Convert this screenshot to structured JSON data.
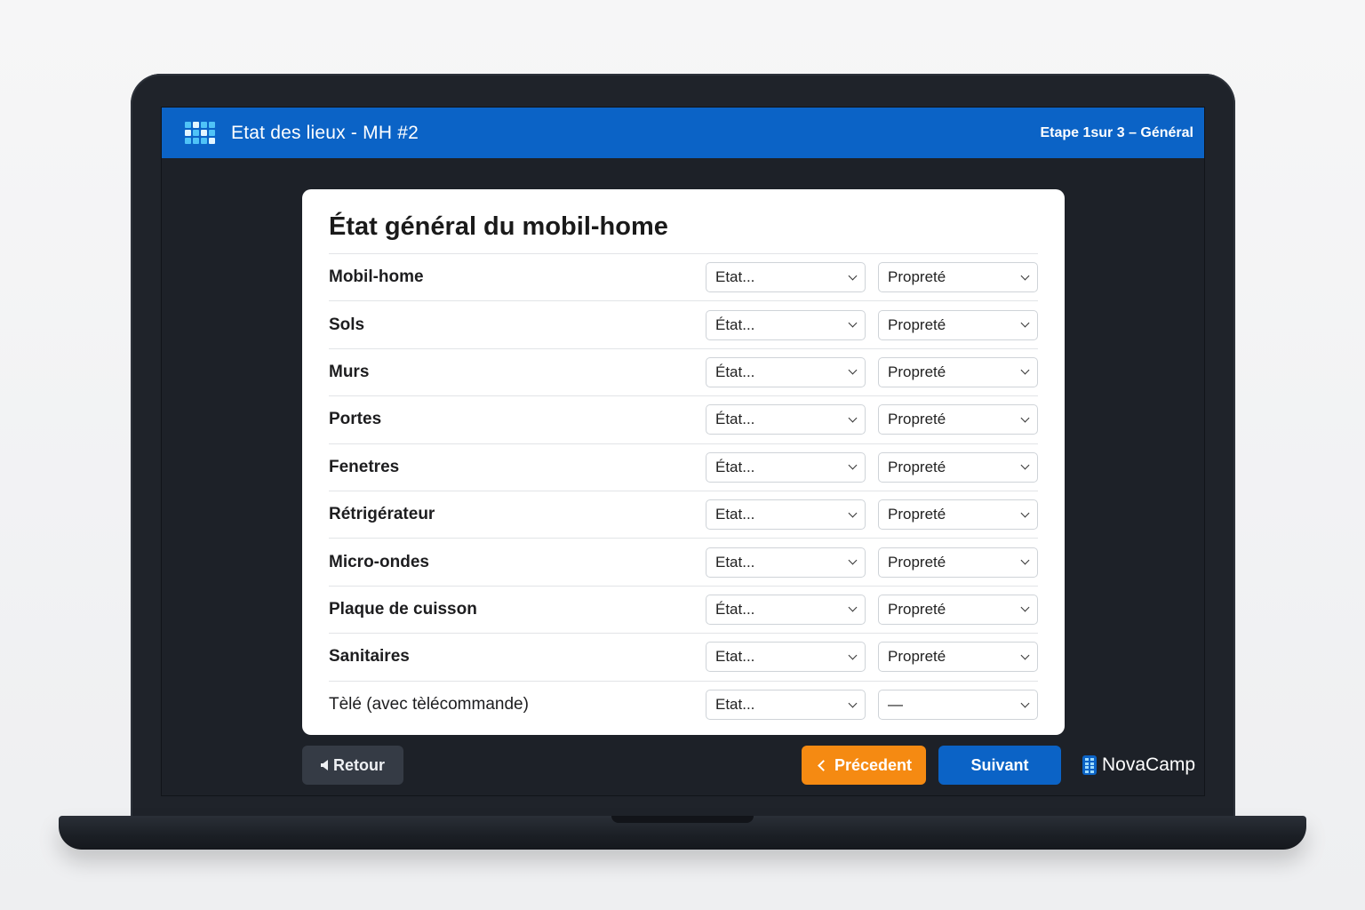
{
  "header": {
    "title": "Etat des lieux - MH #2",
    "step": "Etape 1sur 3 – Général",
    "logo_icon": "grid-logo-icon",
    "color": "#0b63c6"
  },
  "card": {
    "title": "État général du mobil-home",
    "rows": [
      {
        "label": "Mobil-home",
        "etat": "Etat...",
        "proprete": "Propreté"
      },
      {
        "label": "Sols",
        "etat": "État...",
        "proprete": "Propreté"
      },
      {
        "label": "Murs",
        "etat": "État...",
        "proprete": "Propreté"
      },
      {
        "label": "Portes",
        "etat": "État...",
        "proprete": "Propreté"
      },
      {
        "label": "Fenetres",
        "etat": "État...",
        "proprete": "Propreté"
      },
      {
        "label": "Rétrigérateur",
        "etat": "Etat...",
        "proprete": "Propreté"
      },
      {
        "label": "Micro-ondes",
        "etat": "Etat...",
        "proprete": "Propreté"
      },
      {
        "label": "Plaque de cuisson",
        "etat": "État...",
        "proprete": "Propreté"
      },
      {
        "label": "Sanitaires",
        "etat": "Etat...",
        "proprete": "Propreté"
      },
      {
        "label": "Tèlé (avec tèlécommande)",
        "etat": "Etat...",
        "proprete": "—"
      }
    ]
  },
  "footer": {
    "back_label": "Retour",
    "prev_label": "Précedent",
    "next_label": "Suivant",
    "brand": "NovaCamp",
    "prev_color": "#f58a12",
    "next_color": "#0b63c6"
  }
}
